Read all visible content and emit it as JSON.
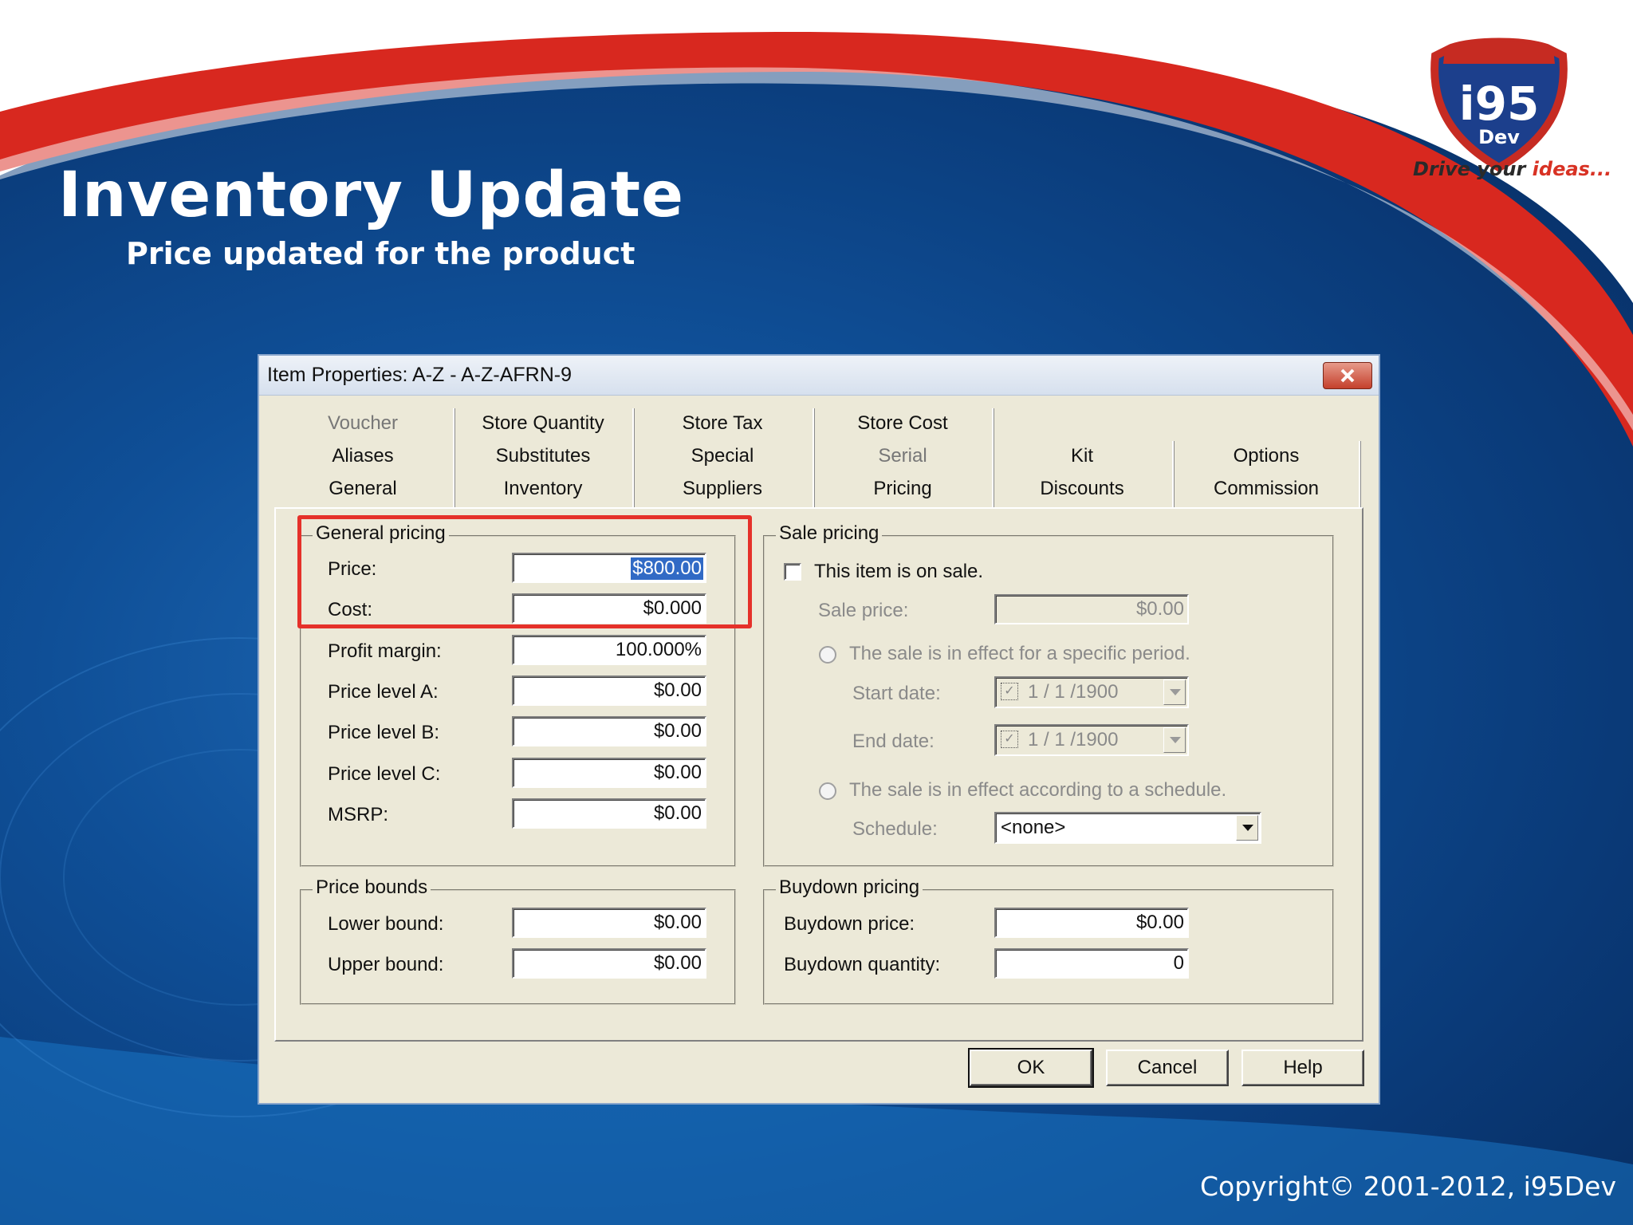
{
  "slide": {
    "title": "Inventory Update",
    "subtitle": "Price updated for the product",
    "logo_text": "i95",
    "logo_subtext": "Dev",
    "logo_tagline_start": "Drive your ",
    "logo_tagline_end": "ideas...",
    "copyright": "Copyright© 2001-2012, i95Dev"
  },
  "dialog": {
    "title": "Item Properties: A-Z - A-Z-AFRN-9",
    "tabs_row1": [
      {
        "label": "Voucher",
        "disabled": true
      },
      {
        "label": "Store Quantity",
        "disabled": false
      },
      {
        "label": "Store Tax",
        "disabled": false
      },
      {
        "label": "Store Cost",
        "disabled": false
      }
    ],
    "tabs_row2": [
      {
        "label": "Aliases",
        "disabled": false
      },
      {
        "label": "Substitutes",
        "disabled": false
      },
      {
        "label": "Special",
        "disabled": false
      },
      {
        "label": "Serial",
        "disabled": true
      },
      {
        "label": "Kit",
        "disabled": false
      },
      {
        "label": "Options",
        "disabled": false
      }
    ],
    "tabs_row3": [
      {
        "label": "General",
        "disabled": false
      },
      {
        "label": "Inventory",
        "disabled": false
      },
      {
        "label": "Suppliers",
        "disabled": false
      },
      {
        "label": "Pricing",
        "disabled": false,
        "active": true
      },
      {
        "label": "Discounts",
        "disabled": false
      },
      {
        "label": "Commission",
        "disabled": false
      }
    ],
    "general_pricing": {
      "legend": "General pricing",
      "price_label": "Price:",
      "price_value": "$800.00",
      "cost_label": "Cost:",
      "cost_value": "$0.000",
      "margin_label": "Profit margin:",
      "margin_value": "100.000%",
      "level_a_label": "Price level A:",
      "level_a_value": "$0.00",
      "level_b_label": "Price level B:",
      "level_b_value": "$0.00",
      "level_c_label": "Price level C:",
      "level_c_value": "$0.00",
      "msrp_label": "MSRP:",
      "msrp_value": "$0.00"
    },
    "sale_pricing": {
      "legend": "Sale pricing",
      "on_sale_label": "This item is on sale.",
      "on_sale_checked": false,
      "sale_price_label": "Sale price:",
      "sale_price_value": "$0.00",
      "period_label": "The sale is in effect for a specific period.",
      "start_label": "Start date:",
      "start_value": "1 / 1 /1900",
      "end_label": "End date:",
      "end_value": "1 / 1 /1900",
      "schedule_radio_label": "The sale is in effect according to a schedule.",
      "schedule_label": "Schedule:",
      "schedule_value": "<none>"
    },
    "price_bounds": {
      "legend": "Price bounds",
      "lower_label": "Lower bound:",
      "lower_value": "$0.00",
      "upper_label": "Upper bound:",
      "upper_value": "$0.00"
    },
    "buydown": {
      "legend": "Buydown pricing",
      "price_label": "Buydown price:",
      "price_value": "$0.00",
      "qty_label": "Buydown quantity:",
      "qty_value": "0"
    },
    "buttons": {
      "ok": "OK",
      "cancel": "Cancel",
      "help": "Help"
    }
  },
  "colors": {
    "highlight": "#e5312a",
    "selection": "#316ac5",
    "dialog_bg": "#ece9d8"
  }
}
